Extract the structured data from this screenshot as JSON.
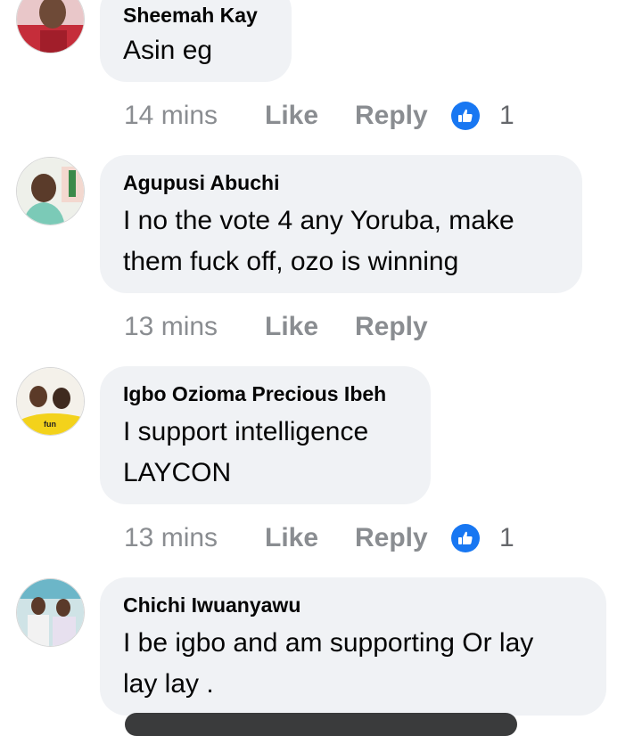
{
  "comments": [
    {
      "author": "Sheemah Kay",
      "lines": [
        "Asin eg"
      ],
      "time": "14 mins",
      "like_label": "Like",
      "reply_label": "Reply",
      "reaction_count": "1",
      "avatar_icon": "user-avatar-photo"
    },
    {
      "author": "Agupusi Abuchi",
      "lines": [
        "I no the vote 4 any Yoruba, make",
        "them fuck off, ozo is winning"
      ],
      "time": "13 mins",
      "like_label": "Like",
      "reply_label": "Reply",
      "avatar_icon": "user-avatar-photo"
    },
    {
      "author": "Igbo Ozioma Precious Ibeh",
      "lines": [
        "I support intelligence",
        "LAYCON"
      ],
      "time": "13 mins",
      "like_label": "Like",
      "reply_label": "Reply",
      "reaction_count": "1",
      "avatar_icon": "user-avatar-photo"
    },
    {
      "author": "Chichi Iwuanyawu",
      "lines": [
        "I be igbo and am supporting Or lay",
        "lay lay ."
      ],
      "avatar_icon": "user-avatar-photo"
    }
  ],
  "colors": {
    "bubble": "#f0f2f5",
    "meta_text": "#8a8d91",
    "like_blue": "#1877f2"
  }
}
